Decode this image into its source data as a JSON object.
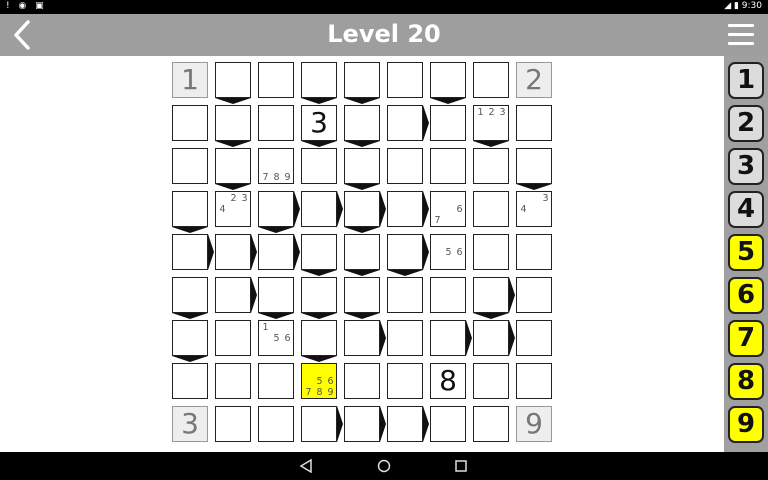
{
  "status_bar": {
    "left_icons": "! ◉ ▣",
    "right": "◢ ▮ 9:30"
  },
  "header": {
    "title": "Level 20"
  },
  "grid": {
    "rows": 9,
    "cols": 9,
    "cells": [
      {
        "big": "1",
        "corner": true
      },
      {
        "wedge": "b"
      },
      {},
      {
        "wedge": "b"
      },
      {
        "wedge": "b"
      },
      {},
      {
        "wedge": "b"
      },
      {},
      {
        "big": "2",
        "corner": true
      },
      {},
      {
        "wedge": "b"
      },
      {},
      {
        "big": "3",
        "wedge": "b"
      },
      {
        "wedge": "b"
      },
      {
        "wedge": "r"
      },
      {},
      {
        "cands": [
          "1",
          "2",
          "3"
        ],
        "wedge": "b"
      },
      {},
      {},
      {
        "wedge": "b"
      },
      {
        "cands": [
          "7",
          "8",
          "9"
        ]
      },
      {},
      {
        "wedge": "b"
      },
      {},
      {},
      {},
      {
        "wedge": "b"
      },
      {
        "wedge": "b"
      },
      {
        "cands": [
          "2",
          "3",
          "4"
        ]
      },
      {
        "wedge": "rb"
      },
      {
        "wedge": "r"
      },
      {
        "wedge": "rb"
      },
      {
        "wedge": "r"
      },
      {
        "cands": [
          "6",
          "7"
        ]
      },
      {},
      {
        "cands": [
          "3",
          "4"
        ]
      },
      {
        "wedge": "r"
      },
      {
        "wedge": "r"
      },
      {
        "wedge": "r"
      },
      {
        "wedge": "b"
      },
      {
        "wedge": "b"
      },
      {
        "wedge": "rb"
      },
      {
        "cands": [
          "5",
          "6"
        ]
      },
      {},
      {},
      {
        "wedge": "b"
      },
      {
        "wedge": "r"
      },
      {
        "wedge": "b"
      },
      {
        "wedge": "b"
      },
      {
        "wedge": "b"
      },
      {},
      {},
      {
        "wedge": "rb"
      },
      {},
      {
        "wedge": "b"
      },
      {},
      {
        "cands": [
          "1",
          "5",
          "6"
        ]
      },
      {
        "wedge": "b"
      },
      {
        "wedge": "r"
      },
      {},
      {
        "wedge": "r"
      },
      {
        "wedge": "r"
      },
      {},
      {},
      {},
      {},
      {
        "cands": [
          "5",
          "6",
          "7",
          "8",
          "9"
        ],
        "selected": true
      },
      {},
      {},
      {
        "big": "8"
      },
      {},
      {},
      {
        "big": "3",
        "corner": true
      },
      {},
      {},
      {
        "wedge": "r"
      },
      {
        "wedge": "r"
      },
      {
        "wedge": "r"
      },
      {},
      {},
      {
        "big": "9",
        "corner": true
      }
    ]
  },
  "number_pad": [
    {
      "label": "1",
      "state": "used"
    },
    {
      "label": "2",
      "state": "used"
    },
    {
      "label": "3",
      "state": "used"
    },
    {
      "label": "4",
      "state": "used"
    },
    {
      "label": "5",
      "state": "available"
    },
    {
      "label": "6",
      "state": "available"
    },
    {
      "label": "7",
      "state": "available"
    },
    {
      "label": "8",
      "state": "available"
    },
    {
      "label": "9",
      "state": "available"
    }
  ],
  "colors": {
    "appbar": "#9e9e9e",
    "selected": "#ffff00",
    "used_button": "#dcdcdc",
    "available_button": "#ffff00"
  }
}
